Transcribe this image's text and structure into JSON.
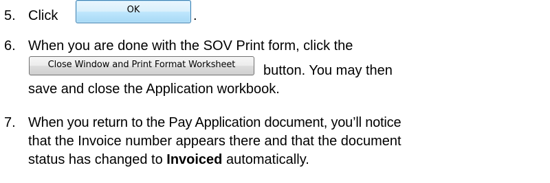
{
  "steps": [
    {
      "number": "5.",
      "text_before": "Click",
      "button_label": "OK",
      "text_after": "."
    },
    {
      "number": "6.",
      "line1": "When you are done with the SOV Print form, click the",
      "button_label": "Close Window and Print Format Worksheet",
      "line2_after": "button.  You may then",
      "line3": "save and close the Application workbook."
    },
    {
      "number": "7.",
      "line1": "When you return to the Pay Application document, you’ll notice",
      "line2": "that the Invoice number appears there and that the document",
      "line3_before": "status has changed to",
      "line3_bold": "Invoiced",
      "line3_after": "automatically."
    }
  ]
}
